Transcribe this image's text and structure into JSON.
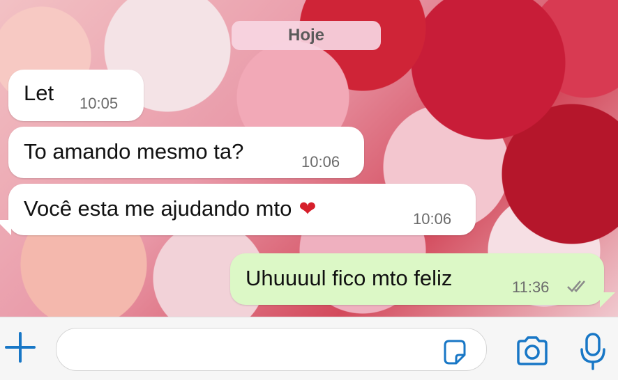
{
  "date_badge": "Hoje",
  "messages": [
    {
      "direction": "in",
      "text": "Let",
      "time": "10:05"
    },
    {
      "direction": "in",
      "text": "To amando mesmo ta?",
      "time": "10:06"
    },
    {
      "direction": "in",
      "text": "Você esta me ajudando mto",
      "emoji": "❤",
      "time": "10:06"
    },
    {
      "direction": "out",
      "text": "Uhuuuul fico mto feliz",
      "time": "11:36",
      "status_icon": "double-check-icon"
    }
  ],
  "composer": {
    "input_value": "",
    "icons": [
      "plus-icon",
      "sticker-icon",
      "camera-icon",
      "microphone-icon"
    ]
  },
  "colors": {
    "incoming_bubble": "#ffffff",
    "outgoing_bubble": "#dcf8c6",
    "accent": "#1877c6"
  }
}
